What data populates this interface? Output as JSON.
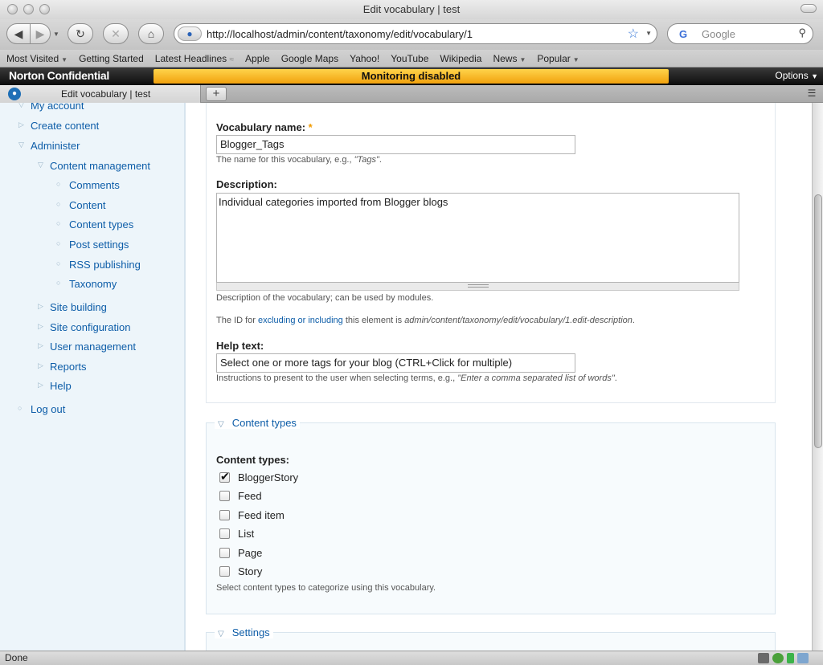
{
  "window": {
    "title": "Edit vocabulary | test"
  },
  "toolbar": {
    "url": "http://localhost/admin/content/taxonomy/edit/vocabulary/1",
    "search_placeholder": "Google",
    "back_icon": "back-arrow-icon",
    "forward_icon": "forward-arrow-icon",
    "reload_icon": "reload-icon",
    "stop_icon": "stop-icon",
    "home_icon": "home-icon"
  },
  "bookmarks": [
    {
      "label": "Most Visited",
      "has_menu": true
    },
    {
      "label": "Getting Started",
      "has_menu": false
    },
    {
      "label": "Latest Headlines",
      "has_menu": false
    },
    {
      "label": "Apple",
      "has_menu": false
    },
    {
      "label": "Google Maps",
      "has_menu": false
    },
    {
      "label": "Yahoo!",
      "has_menu": false
    },
    {
      "label": "YouTube",
      "has_menu": false
    },
    {
      "label": "Wikipedia",
      "has_menu": false
    },
    {
      "label": "News",
      "has_menu": true
    },
    {
      "label": "Popular",
      "has_menu": true
    }
  ],
  "norton": {
    "logo": "Norton Confidential",
    "status": "Monitoring disabled",
    "options": "Options"
  },
  "tab": {
    "title": "Edit vocabulary | test",
    "new_tab": "+"
  },
  "sidebar": {
    "my_account": "My account",
    "create_content": "Create content",
    "administer": "Administer",
    "content_management": "Content management",
    "cm_items": [
      "Comments",
      "Content",
      "Content types",
      "Post settings",
      "RSS publishing",
      "Taxonomy"
    ],
    "site_building": "Site building",
    "site_configuration": "Site configuration",
    "user_management": "User management",
    "reports": "Reports",
    "help": "Help",
    "log_out": "Log out"
  },
  "form": {
    "vocab_name_label": "Vocabulary name:",
    "required_mark": "*",
    "vocab_name_value": "Blogger_Tags",
    "vocab_name_desc_prefix": "The name for this vocabulary, e.g., ",
    "vocab_name_desc_example": "\"Tags\"",
    "vocab_name_desc_suffix": ".",
    "description_label": "Description:",
    "description_value": "Individual categories imported from Blogger blogs",
    "description_desc": "Description of the vocabulary; can be used by modules.",
    "id_prefix": "The ID for ",
    "id_link": "excluding or including",
    "id_middle": " this element is ",
    "id_path": "admin/content/taxonomy/edit/vocabulary/1.edit-description",
    "id_suffix": ".",
    "help_label": "Help text:",
    "help_value": "Select one or more tags for your blog (CTRL+Click for multiple)",
    "help_desc_prefix": "Instructions to present to the user when selecting terms, e.g., ",
    "help_desc_example": "\"Enter a comma separated list of words\"",
    "help_desc_suffix": "."
  },
  "content_types_fieldset": {
    "legend": "Content types",
    "label": "Content types:",
    "options": [
      {
        "label": "BloggerStory",
        "checked": true
      },
      {
        "label": "Feed",
        "checked": false
      },
      {
        "label": "Feed item",
        "checked": false
      },
      {
        "label": "List",
        "checked": false
      },
      {
        "label": "Page",
        "checked": false
      },
      {
        "label": "Story",
        "checked": false
      }
    ],
    "desc": "Select content types to categorize using this vocabulary."
  },
  "settings_fieldset": {
    "legend": "Settings"
  },
  "status": {
    "text": "Done"
  },
  "colors": {
    "link": "#0d5da8",
    "norton_status": "#f6b21d",
    "sidebar_bg": "#edf5fa"
  }
}
